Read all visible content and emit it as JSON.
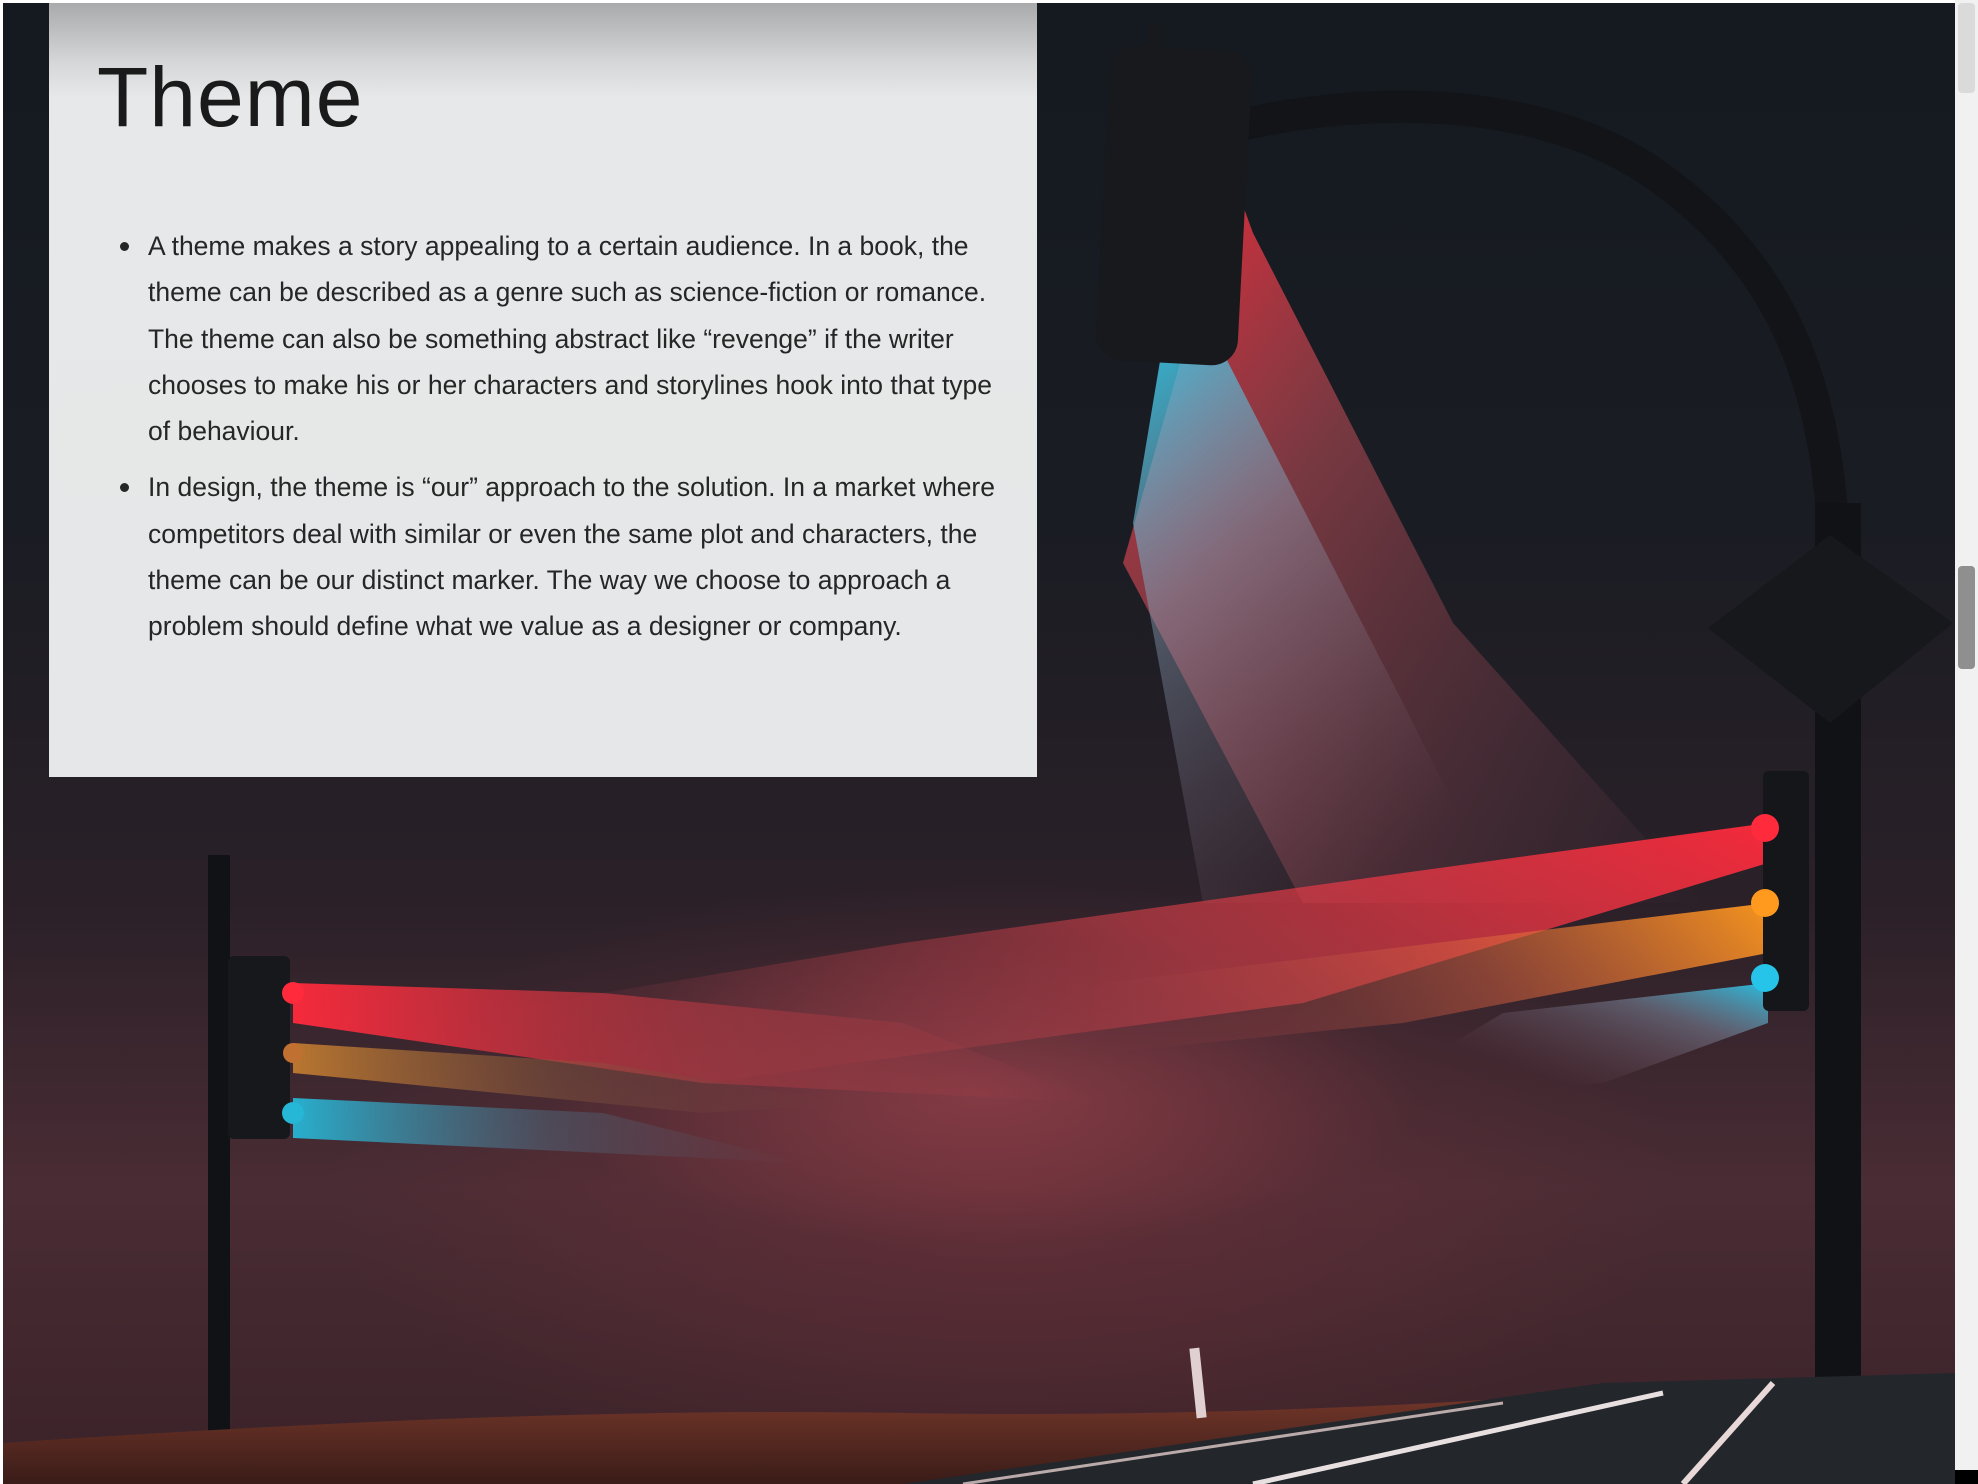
{
  "card": {
    "title": "Theme",
    "bullets": [
      "A theme makes a story appealing to a certain audience. In a book, the theme can be described as a genre such as science-fiction or romance. The theme can also be something abstract like “revenge” if the writer chooses to make his or her characters and storylines hook into that type of behaviour.",
      "In design, the theme is “our” approach to the solution. In a market where competitors deal with similar or even the same plot and characters, the theme can be our distinct marker. The way we choose to approach a problem should define what we value as a designer or company."
    ]
  },
  "colors": {
    "card_bg": "#e6e7e8",
    "text": "#262626",
    "light_red": "#ff2a3c",
    "light_amber": "#ff9a1e",
    "light_cyan": "#26c4e8"
  },
  "background": {
    "subject": "traffic-lights-in-fog-photo"
  },
  "scrollbar": {
    "position_fraction": 0.41
  }
}
